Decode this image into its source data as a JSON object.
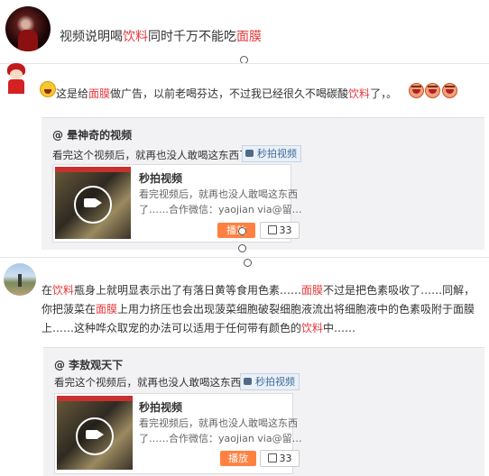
{
  "post": {
    "title_part1": "视频说明喝",
    "title_hl1": "饮料",
    "title_part2": "同时千万不能吃",
    "title_hl2": "面膜"
  },
  "comment1": {
    "text_part1": "这是给",
    "text_hl1": "面膜",
    "text_part2": "做广告，以前老喝芬达，不过我已经很久不喝碳酸",
    "text_hl2": "饮料",
    "text_part3": "了，。"
  },
  "repost1": {
    "user": "@ 晕神奇的视频",
    "text": "看完这个视频后，就再也没人敢喝这东西了。",
    "tag": "秒拍视频",
    "video_title": "秒拍视频",
    "video_desc_line1": "看完视频后，就再也没人敢喝这东西",
    "video_desc_line2": "了……合作微信：yaojian via@留…",
    "play_label": "播放",
    "like_count": "33"
  },
  "comment2": {
    "seg1": "在",
    "hl1": "饮料",
    "seg2": "瓶身上就明显表示出了有落日黄等食用色素……",
    "hl2": "面膜",
    "seg3": "不过是把色素吸收了……同解，你把菠菜在",
    "hl3": "面膜",
    "seg4": "上用力挤压也会出现菠菜细胞破裂细胞液流出将细胞液中的色素吸附于面膜上……这种哗众取宠的办法可以适用于任何带有颜色的",
    "hl4": "饮料",
    "seg5": "中……"
  },
  "repost2": {
    "user": "@ 李敖观天下",
    "text": "看完这个视频后，就再也没人敢喝这东西了.",
    "tag": "秒拍视频",
    "video_title": "秒拍视频",
    "video_desc_line1": "看完视频后，就再也没人敢喝这东西",
    "video_desc_line2": "了……合作微信：yaojian via@留…",
    "play_label": "播放",
    "like_count": "33"
  }
}
